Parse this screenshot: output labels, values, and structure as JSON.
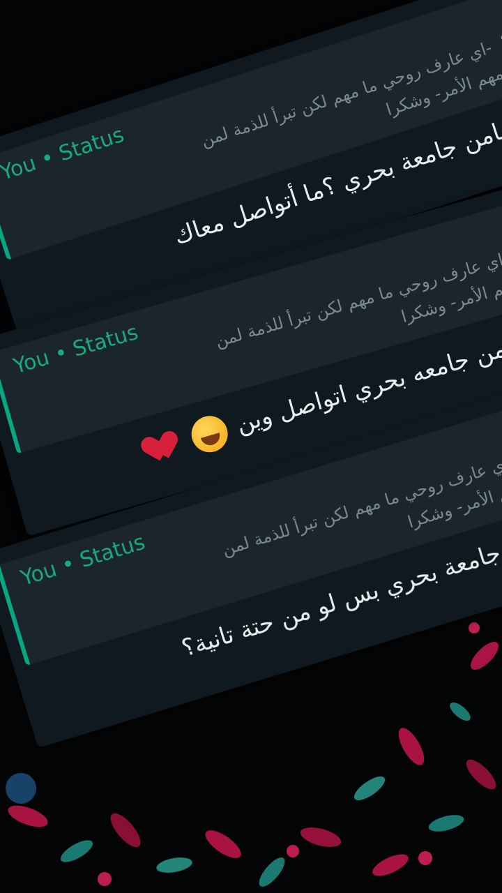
{
  "colors": {
    "background": "#030405",
    "card": "#101920",
    "quote": "#1b252c",
    "accent": "#06a884",
    "floral_pink": "#c8174f",
    "floral_teal": "#1f8f86"
  },
  "cards": [
    {
      "quote_sender": "You • Status",
      "quote_line1": "-اي عارف روحي ما مهم لكن تبرأ للذمة لمن",
      "quote_line2": "يفهمهم الأمر- وشكرا",
      "message": "ولو مامن جامعة بحري ؟ما أتواصل معاك"
    },
    {
      "quote_sender": "You • Status",
      "quote_line1": "-اي عارف روحي ما مهم لكن تبرأ للذمة لمن",
      "quote_line2": "يفهمهم الأمر- وشكرا",
      "message": "لو برا من جامعه بحري اتواصل وين",
      "emojis": [
        "face-with-tears-of-joy",
        "broken-heart"
      ]
    },
    {
      "quote_sender": "You • Status",
      "quote_line1": "-اي عارف روحي ما مهم لكن تبرأ للذمة لمن",
      "quote_line2": "يفهمهم الأمر- وشكرا",
      "message": "ليه من جامعة بحري بس لو من حتة تانية؟"
    }
  ],
  "icons": {
    "walking": "person-walking-icon"
  }
}
